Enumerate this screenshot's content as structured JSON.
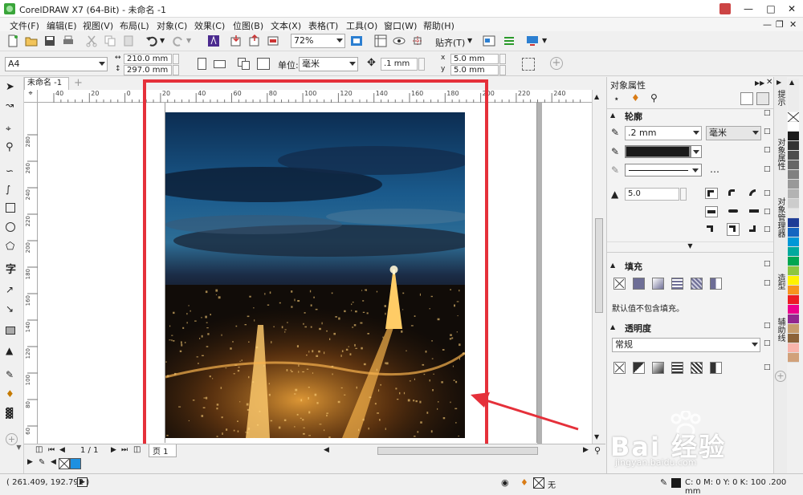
{
  "window": {
    "title": "CorelDRAW X7 (64-Bit) - 未命名 -1"
  },
  "menu": [
    "文件(F)",
    "编辑(E)",
    "视图(V)",
    "布局(L)",
    "对象(C)",
    "效果(C)",
    "位图(B)",
    "文本(X)",
    "表格(T)",
    "工具(O)",
    "窗口(W)",
    "帮助(H)"
  ],
  "toolbar": {
    "zoom": "72%",
    "snap_label": "贴齐(T)"
  },
  "property_bar": {
    "paper_size": "A4",
    "width": "210.0 mm",
    "height": "297.0 mm",
    "unit_label": "单位:",
    "unit": "毫米",
    "nudge": ".1 mm",
    "dup_x": "5.0 mm",
    "dup_y": "5.0 mm"
  },
  "document": {
    "tab": "未命名 -1"
  },
  "ruler_h": [
    "40",
    "20",
    "0",
    "20",
    "40",
    "60",
    "80",
    "100",
    "120",
    "140",
    "160",
    "180",
    "200",
    "220",
    "240"
  ],
  "ruler_v": [
    "280",
    "260",
    "240",
    "220",
    "200",
    "180",
    "160",
    "140",
    "120",
    "100",
    "80",
    "60"
  ],
  "page_nav": {
    "count": "1 / 1",
    "page_tab": "页 1"
  },
  "status": {
    "coords": "( 261.409, 192.792 )",
    "fill_none": "无",
    "outline": "C: 0 M: 0 Y: 0 K: 100  .200 mm"
  },
  "panel": {
    "title": "对象属性",
    "outline": {
      "header": "轮廓",
      "width": ".2 mm",
      "unit": "毫米",
      "miter": "5.0"
    },
    "fill": {
      "header": "填充",
      "note": "默认值不包含填充。"
    },
    "transparency": {
      "header": "透明度",
      "mode": "常规"
    }
  },
  "side_tabs": [
    "提示",
    "对象属性",
    "对象管理器",
    "造型",
    "辅助线"
  ],
  "palette": [
    "#ffffff",
    "#1a1a1a",
    "#333333",
    "#4d4d4d",
    "#666666",
    "#808080",
    "#999999",
    "#b3b3b3",
    "#cccccc",
    "#e6e6e6",
    "#1e3c96",
    "#1565c0",
    "#0097d7",
    "#00a99d",
    "#00a651",
    "#8dc63f",
    "#fff200",
    "#f7941d",
    "#ed1c24",
    "#ec008c",
    "#92278f",
    "#c69c6d",
    "#8c6239",
    "#f9b4ab",
    "#d1a17a"
  ],
  "watermark": {
    "text": "Bai 经验",
    "url": "jingyan.baidu.com"
  },
  "colors": {
    "highlight": "#e5303a",
    "accent": "#3aa53a"
  }
}
